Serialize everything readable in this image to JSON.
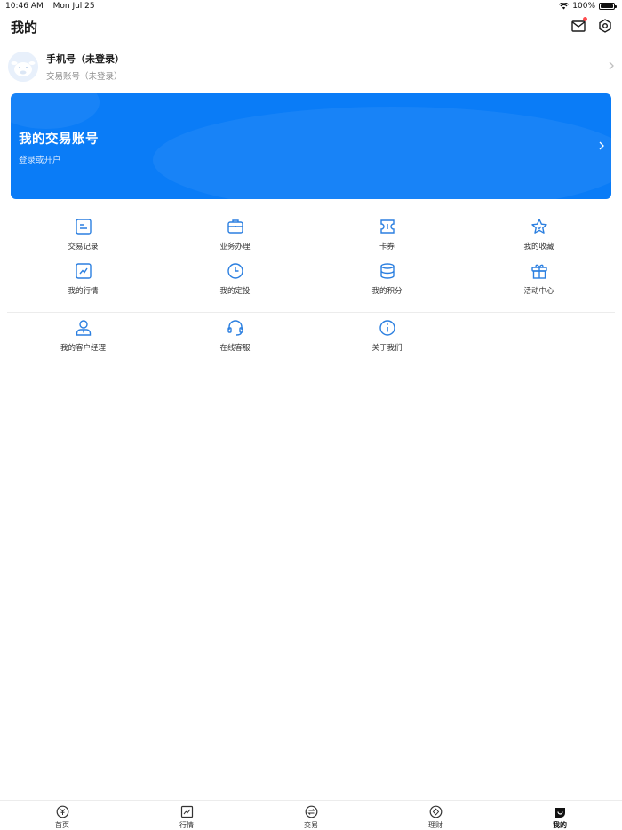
{
  "status_bar": {
    "time": "10:46 AM",
    "date": "Mon Jul 25",
    "battery": "100%",
    "battery_level": 1.0
  },
  "header": {
    "title": "我的",
    "icons": [
      "mail-icon",
      "settings-icon"
    ]
  },
  "profile": {
    "name": "手机号（未登录）",
    "subtitle": "交易账号（未登录）"
  },
  "account_card": {
    "title": "我的交易账号",
    "subtitle": "登录或开户"
  },
  "grid_primary": [
    {
      "label": "交易记录",
      "icon": "record-icon"
    },
    {
      "label": "业务办理",
      "icon": "briefcase-icon"
    },
    {
      "label": "卡券",
      "icon": "ticket-icon"
    },
    {
      "label": "我的收藏",
      "icon": "star-icon"
    },
    {
      "label": "我的行情",
      "icon": "chart-icon"
    },
    {
      "label": "我的定投",
      "icon": "clock-icon"
    },
    {
      "label": "我的积分",
      "icon": "coins-icon"
    },
    {
      "label": "活动中心",
      "icon": "gift-icon"
    }
  ],
  "grid_secondary": [
    {
      "label": "我的客户经理",
      "icon": "manager-icon"
    },
    {
      "label": "在线客服",
      "icon": "headset-icon"
    },
    {
      "label": "关于我们",
      "icon": "info-icon"
    }
  ],
  "tab_bar": [
    {
      "label": "首页",
      "icon": "home-yen-icon",
      "active": false
    },
    {
      "label": "行情",
      "icon": "market-icon",
      "active": false
    },
    {
      "label": "交易",
      "icon": "trade-icon",
      "active": false
    },
    {
      "label": "理财",
      "icon": "finance-icon",
      "active": false
    },
    {
      "label": "我的",
      "icon": "mine-icon",
      "active": true
    }
  ],
  "colors": {
    "accent": "#0a7cf7",
    "icon_blue": "#2b7fe0",
    "text": "#1a1a1a",
    "muted": "#8c8c8c"
  }
}
